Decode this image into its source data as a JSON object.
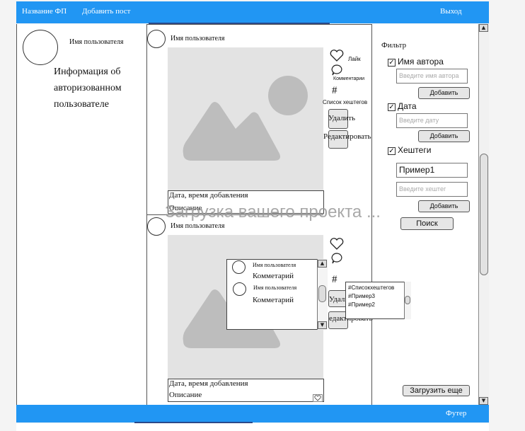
{
  "header": {
    "site_name": "Название ФП",
    "add_post": "Добавить пост",
    "logout": "Выход"
  },
  "profile": {
    "username": "Имя пользователя",
    "info": "Информация об авторизованном пользователе"
  },
  "posts": [
    {
      "username": "Имя пользователя",
      "like": "Лайк",
      "comments": "Комментарии",
      "hashtags": "Список хештегов",
      "delete": "Удалить",
      "edit": "Редактировать",
      "date": "Дата, время добавления",
      "description": "Описание"
    },
    {
      "username": "Имя пользователя",
      "delete": "Удали",
      "edit": "едактировать",
      "date": "Дата, время добавления",
      "description": "Описание"
    }
  ],
  "loading": "Загрузка вашего проекта ...",
  "comments_popup": {
    "items": [
      {
        "username": "Имя пользователя",
        "text": "Комметарий"
      },
      {
        "username": "Имя пользователя",
        "text": "Комметарий"
      }
    ]
  },
  "hashtag_popup": {
    "items": [
      "#Списокхештегов",
      "#Пример3",
      "#Пример2"
    ]
  },
  "filter": {
    "title": "Фильтр",
    "author": {
      "label": "Имя автора",
      "placeholder": "Введите имя автора",
      "button": "Добавить"
    },
    "date": {
      "label": "Дата",
      "placeholder": "Введите дату",
      "button": "Добавить"
    },
    "hashtags": {
      "label": "Хештеги",
      "value": "Пример1",
      "placeholder": "Введите хештег",
      "button": "Добавить"
    },
    "search": "Поиск"
  },
  "load_more": "Загрузить еще",
  "footer": "Футер"
}
